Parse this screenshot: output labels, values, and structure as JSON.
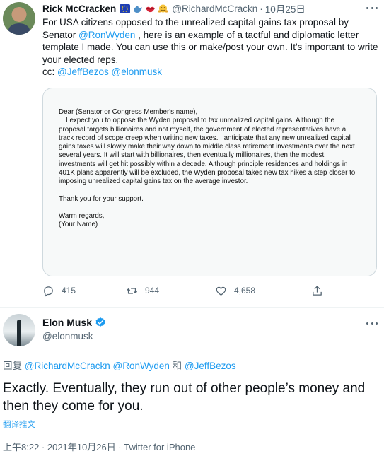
{
  "tweet1": {
    "author_name": "Rick McCracken",
    "emoji_icons": [
      "eu-flag-icon",
      "teapot-icon",
      "lips-icon",
      "hugging-face-icon"
    ],
    "handle": "@RichardMcCrackn",
    "separator": "·",
    "date": "10月25日",
    "text_before_mention": "For USA citizens opposed to the unrealized capital gains tax proposal by Senator ",
    "mention_wyden": "@RonWyden",
    "text_after_mention": " , here is an example of a tactful and diplomatic letter template I made. You can use this or make/post your own. It's important to write your elected reps.",
    "cc_label": "cc: ",
    "mention_bezos": "@JeffBezos",
    "mention_musk": "@elonmusk",
    "letter": {
      "salutation": "Dear (Senator or Congress Member's name),",
      "paragraph": "I expect you to oppose the Wyden proposal to tax unrealized capital gains. Although the proposal targets billionaires and not myself, the government of elected representatives have a track record of scope creep when writing new taxes. I anticipate that any new unrealized capital gains taxes will slowly make their way down to middle class retirement investments over the next several years. It will start with billionaires, then eventually millionaires, then the modest investments will get hit possibly within a decade. Although principle residences and holdings in 401K plans apparently will be excluded, the Wyden proposal takes new tax hikes a step closer to imposing unrealized capital gains tax on the average investor.",
      "thanks": "Thank you for your support.",
      "closing": "Warm regards,",
      "signature": "(Your Name)"
    },
    "stats": {
      "replies": "415",
      "retweets": "944",
      "likes": "4,658"
    }
  },
  "tweet2": {
    "author_name": "Elon Musk",
    "verified_icon": "verified-badge-icon",
    "handle": "@elonmusk",
    "replying_prefix": "回复 ",
    "replying_users": "@RichardMcCrackn @RonWyden",
    "replying_and": " 和 ",
    "replying_last": "@JeffBezos",
    "text": "Exactly. Eventually, they run out of other people’s money and then they come for you.",
    "translate_label": "翻译推文",
    "meta": "上午8:22 · 2021年10月26日 · Twitter for iPhone"
  },
  "colors": {
    "link": "#1d9bf0",
    "secondary_text": "#536471",
    "primary_text": "#0f1419"
  }
}
